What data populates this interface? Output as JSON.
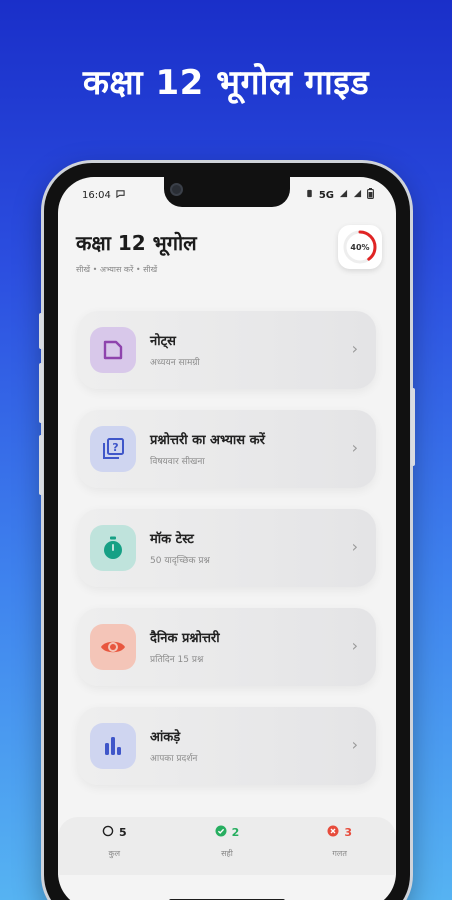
{
  "headline": "कक्षा 12 भूगोल गाइड",
  "status": {
    "time": "16:04",
    "network": "5G",
    "battery_icon": "battery-icon"
  },
  "header": {
    "title": "कक्षा 12 भूगोल",
    "breadcrumb": "सीखें • अभ्यास करें • सीखें",
    "progress": {
      "value": 40,
      "label": "40%",
      "color": "#e02424"
    }
  },
  "cards": [
    {
      "title": "नोट्स",
      "subtitle": "अध्ययन सामग्री",
      "icon": "document-icon",
      "color": "#8e44ad",
      "bg": "#d8c8ea"
    },
    {
      "title": "प्रश्नोत्तरी का अभ्यास करें",
      "subtitle": "विषयवार सीखना",
      "icon": "quiz-icon",
      "color": "#3f56c9",
      "bg": "#cfd5f0"
    },
    {
      "title": "मॉक टेस्ट",
      "subtitle": "50 यादृच्छिक प्रश्न",
      "icon": "timer-icon",
      "color": "#16a085",
      "bg": "#bfe3dc"
    },
    {
      "title": "दैनिक प्रश्नोत्तरी",
      "subtitle": "प्रतिदिन 15 प्रश्न",
      "icon": "eye-icon",
      "color": "#e8573f",
      "bg": "#f4c5b8"
    },
    {
      "title": "आंकड़े",
      "subtitle": "आपका प्रदर्शन",
      "icon": "bar-chart-icon",
      "color": "#3f56c9",
      "bg": "#cfd5f0"
    }
  ],
  "stats": [
    {
      "count": "5",
      "label": "कुल",
      "icon": "circle-icon",
      "color": "#222222"
    },
    {
      "count": "2",
      "label": "सही",
      "icon": "check-circle-icon",
      "color": "#27ae60"
    },
    {
      "count": "3",
      "label": "गलत",
      "icon": "x-circle-icon",
      "color": "#e74c3c"
    }
  ]
}
